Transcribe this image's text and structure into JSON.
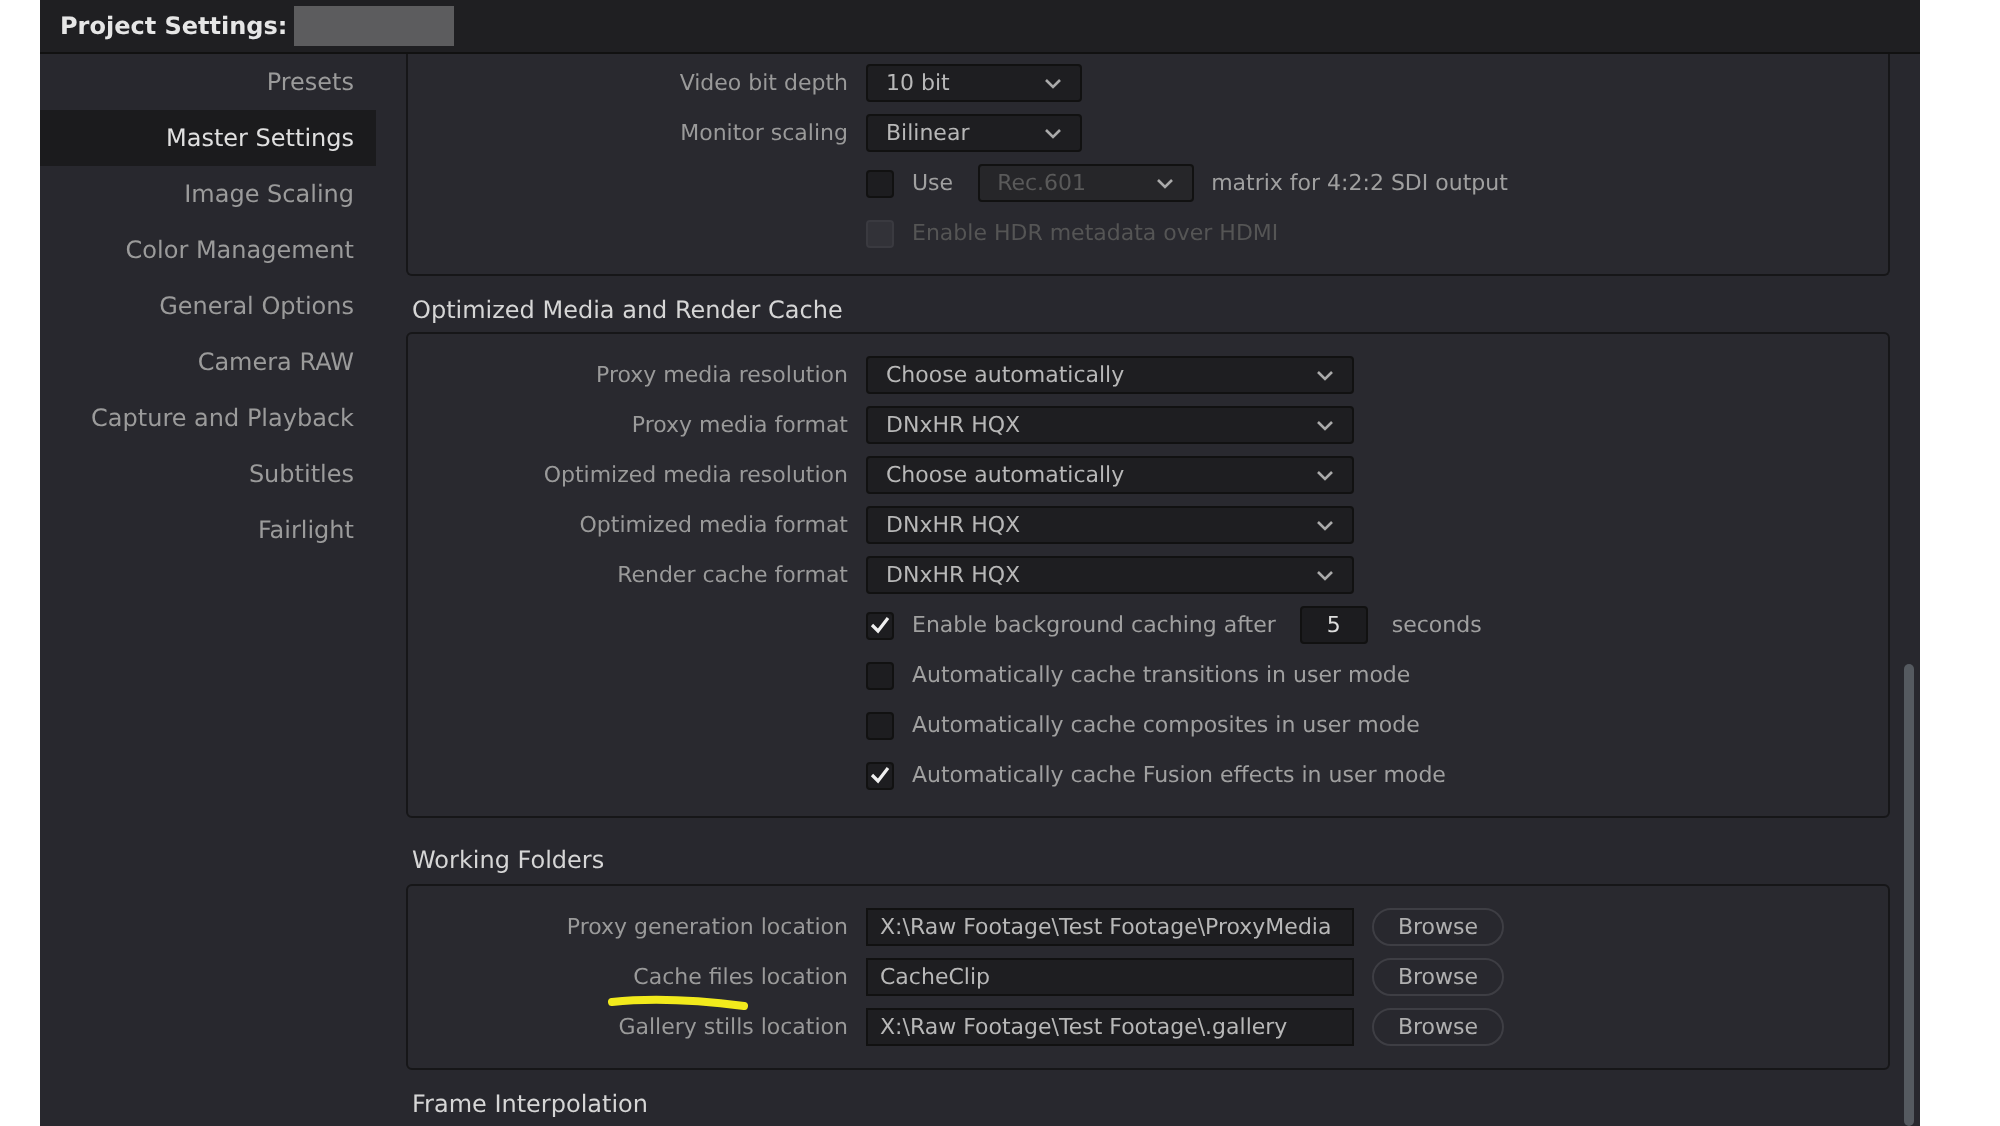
{
  "window": {
    "title": "Project Settings:"
  },
  "sidebar": {
    "items": [
      {
        "label": "Presets",
        "selected": false
      },
      {
        "label": "Master Settings",
        "selected": true
      },
      {
        "label": "Image Scaling",
        "selected": false
      },
      {
        "label": "Color Management",
        "selected": false
      },
      {
        "label": "General Options",
        "selected": false
      },
      {
        "label": "Camera RAW",
        "selected": false
      },
      {
        "label": "Capture and Playback",
        "selected": false
      },
      {
        "label": "Subtitles",
        "selected": false
      },
      {
        "label": "Fairlight",
        "selected": false
      }
    ]
  },
  "video_panel": {
    "rows": [
      {
        "kind": "dropdown",
        "label": "Video bit depth",
        "value": "10 bit"
      },
      {
        "kind": "dropdown",
        "label": "Monitor scaling",
        "value": "Bilinear"
      },
      {
        "kind": "matrix",
        "label": "Use",
        "checked": false,
        "value": "Rec.601",
        "dropdown_disabled": true,
        "suffix": "matrix for 4:2:2 SDI output"
      },
      {
        "kind": "checkbox",
        "label": "Enable HDR metadata over HDMI",
        "checked": false,
        "disabled": true
      }
    ]
  },
  "cache_section": {
    "title": "Optimized Media and Render Cache",
    "rows": [
      {
        "kind": "dropdown",
        "label": "Proxy media resolution",
        "value": "Choose automatically"
      },
      {
        "kind": "dropdown",
        "label": "Proxy media format",
        "value": "DNxHR HQX"
      },
      {
        "kind": "dropdown",
        "label": "Optimized media resolution",
        "value": "Choose automatically"
      },
      {
        "kind": "dropdown",
        "label": "Optimized media format",
        "value": "DNxHR HQX"
      },
      {
        "kind": "dropdown",
        "label": "Render cache format",
        "value": "DNxHR HQX"
      },
      {
        "kind": "checkbox_number",
        "label": "Enable background caching after",
        "checked": true,
        "disabled": false,
        "value": "5",
        "unit": "seconds"
      },
      {
        "kind": "checkbox",
        "label": "Automatically cache transitions in user mode",
        "checked": false,
        "disabled": false
      },
      {
        "kind": "checkbox",
        "label": "Automatically cache composites in user mode",
        "checked": false,
        "disabled": false
      },
      {
        "kind": "checkbox",
        "label": "Automatically cache Fusion effects in user mode",
        "checked": true,
        "disabled": false
      }
    ]
  },
  "working_folders": {
    "title": "Working Folders",
    "rows": [
      {
        "label": "Proxy generation location",
        "value": "X:\\Raw Footage\\Test Footage\\ProxyMedia",
        "button": "Browse",
        "highlighted": false
      },
      {
        "label": "Cache files location",
        "value": "CacheClip",
        "button": "Browse",
        "highlighted": true
      },
      {
        "label": "Gallery stills location",
        "value": "X:\\Raw Footage\\Test Footage\\.gallery",
        "button": "Browse",
        "highlighted": false
      }
    ]
  },
  "next_section": {
    "title": "Frame Interpolation"
  }
}
